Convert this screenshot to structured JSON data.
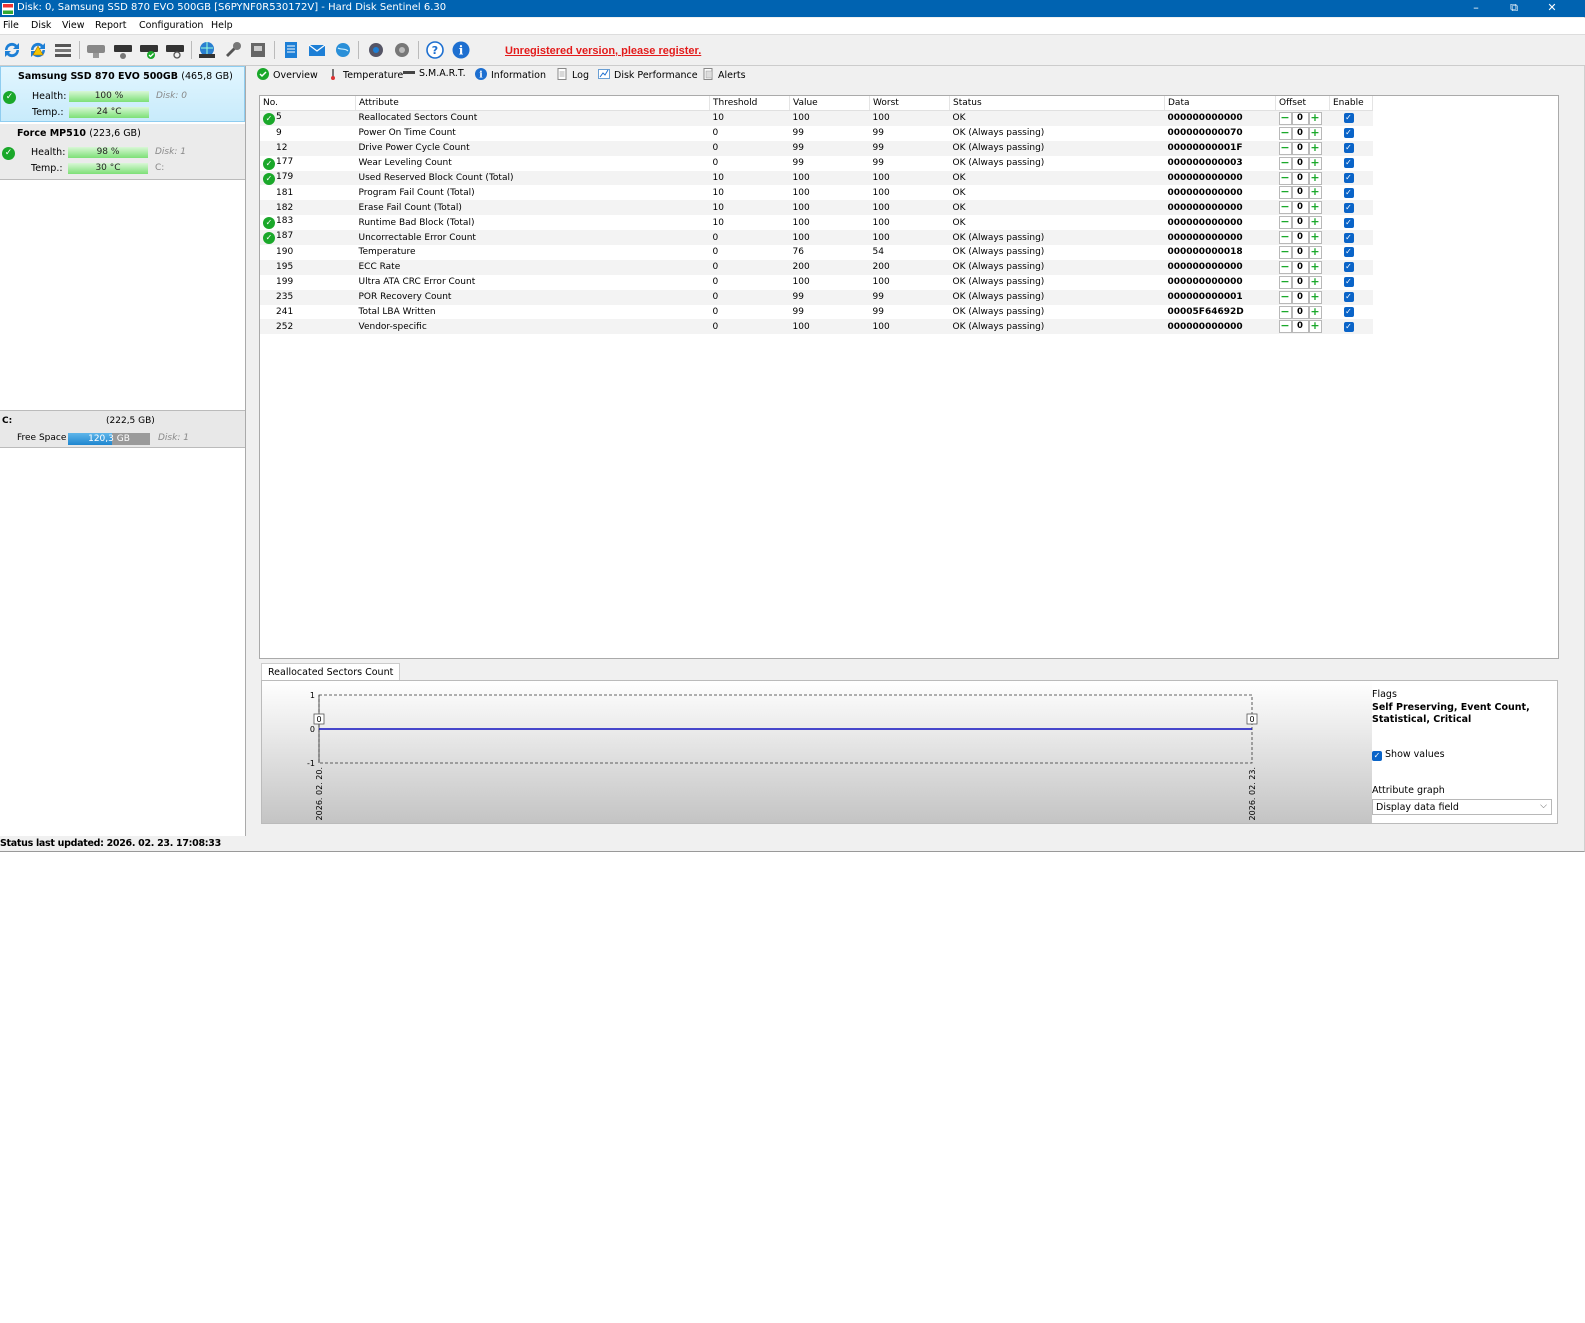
{
  "window": {
    "title": "Disk: 0, Samsung SSD 870 EVO 500GB [S6PYNF0R530172V]  -  Hard Disk Sentinel 6.30",
    "minimize": "–",
    "restore": "⧉",
    "close": "✕"
  },
  "menu": [
    "File",
    "Disk",
    "View",
    "Report",
    "Configuration",
    "Help"
  ],
  "toolbar": {
    "register_link": "Unregistered version, please register."
  },
  "disks": [
    {
      "name": "Samsung SSD 870 EVO 500GB",
      "capacity": "(465,8 GB)",
      "health_label": "Health:",
      "health": "100 %",
      "health_level": 1.0,
      "disk_label": "Disk: 0",
      "temp_label": "Temp.:",
      "temp": "24 °C",
      "extra": ""
    },
    {
      "name": "Force MP510",
      "capacity": "(223,6 GB)",
      "health_label": "Health:",
      "health": "98 %",
      "health_level": 0.98,
      "disk_label": "Disk: 1",
      "temp_label": "Temp.:",
      "temp": "30 °C",
      "extra": "C:"
    }
  ],
  "volume": {
    "letter": "C:",
    "size": "(222,5 GB)",
    "free_label": "Free Space",
    "free": "120,3 GB",
    "disk_label": "Disk: 1"
  },
  "tabs": [
    "Overview",
    "Temperature",
    "S.M.A.R.T.",
    "Information",
    "Log",
    "Disk Performance",
    "Alerts"
  ],
  "smart": {
    "headers": [
      "No.",
      "Attribute",
      "Threshold",
      "Value",
      "Worst",
      "Status",
      "Data",
      "Offset",
      "Enable"
    ],
    "rows": [
      {
        "no": "5",
        "ok": true,
        "attr": "Reallocated Sectors Count",
        "thr": "10",
        "val": "100",
        "worst": "100",
        "status": "OK",
        "data": "000000000000",
        "offset": "0"
      },
      {
        "no": "9",
        "ok": false,
        "attr": "Power On Time Count",
        "thr": "0",
        "val": "99",
        "worst": "99",
        "status": "OK (Always passing)",
        "data": "000000000070",
        "offset": "0"
      },
      {
        "no": "12",
        "ok": false,
        "attr": "Drive Power Cycle Count",
        "thr": "0",
        "val": "99",
        "worst": "99",
        "status": "OK (Always passing)",
        "data": "00000000001F",
        "offset": "0"
      },
      {
        "no": "177",
        "ok": true,
        "attr": "Wear Leveling Count",
        "thr": "0",
        "val": "99",
        "worst": "99",
        "status": "OK (Always passing)",
        "data": "000000000003",
        "offset": "0"
      },
      {
        "no": "179",
        "ok": true,
        "attr": "Used Reserved Block Count (Total)",
        "thr": "10",
        "val": "100",
        "worst": "100",
        "status": "OK",
        "data": "000000000000",
        "offset": "0"
      },
      {
        "no": "181",
        "ok": false,
        "attr": "Program Fail Count (Total)",
        "thr": "10",
        "val": "100",
        "worst": "100",
        "status": "OK",
        "data": "000000000000",
        "offset": "0"
      },
      {
        "no": "182",
        "ok": false,
        "attr": "Erase Fail Count (Total)",
        "thr": "10",
        "val": "100",
        "worst": "100",
        "status": "OK",
        "data": "000000000000",
        "offset": "0"
      },
      {
        "no": "183",
        "ok": true,
        "attr": "Runtime Bad Block (Total)",
        "thr": "10",
        "val": "100",
        "worst": "100",
        "status": "OK",
        "data": "000000000000",
        "offset": "0"
      },
      {
        "no": "187",
        "ok": true,
        "attr": "Uncorrectable Error Count",
        "thr": "0",
        "val": "100",
        "worst": "100",
        "status": "OK (Always passing)",
        "data": "000000000000",
        "offset": "0"
      },
      {
        "no": "190",
        "ok": false,
        "attr": "Temperature",
        "thr": "0",
        "val": "76",
        "worst": "54",
        "status": "OK (Always passing)",
        "data": "000000000018",
        "offset": "0"
      },
      {
        "no": "195",
        "ok": false,
        "attr": "ECC Rate",
        "thr": "0",
        "val": "200",
        "worst": "200",
        "status": "OK (Always passing)",
        "data": "000000000000",
        "offset": "0"
      },
      {
        "no": "199",
        "ok": false,
        "attr": "Ultra ATA CRC Error Count",
        "thr": "0",
        "val": "100",
        "worst": "100",
        "status": "OK (Always passing)",
        "data": "000000000000",
        "offset": "0"
      },
      {
        "no": "235",
        "ok": false,
        "attr": "POR Recovery Count",
        "thr": "0",
        "val": "99",
        "worst": "99",
        "status": "OK (Always passing)",
        "data": "000000000001",
        "offset": "0"
      },
      {
        "no": "241",
        "ok": false,
        "attr": "Total LBA Written",
        "thr": "0",
        "val": "99",
        "worst": "99",
        "status": "OK (Always passing)",
        "data": "00005F64692D",
        "offset": "0"
      },
      {
        "no": "252",
        "ok": false,
        "attr": "Vendor-specific",
        "thr": "0",
        "val": "100",
        "worst": "100",
        "status": "OK (Always passing)",
        "data": "000000000000",
        "offset": "0"
      }
    ]
  },
  "graph": {
    "tab_label": "Reallocated Sectors Count",
    "y_ticks": [
      "1",
      "0",
      "-1"
    ],
    "x_labels": [
      "2026. 02. 20.",
      "2026. 02. 23."
    ],
    "points": [
      {
        "date": "2026. 02. 20.",
        "value": 0
      },
      {
        "date": "2026. 02. 23.",
        "value": 0
      }
    ],
    "line_color": "#1010c0"
  },
  "flags": {
    "title": "Flags",
    "value": "Self Preserving, Event Count, Statistical, Critical",
    "show_values_label": "Show values",
    "attribute_graph_label": "Attribute graph",
    "attribute_graph_value": "Display data field"
  },
  "status": {
    "text": "Status last updated: 2026. 02. 23. 17:08:33"
  },
  "colors": {
    "titlebar": "#0063b1",
    "register": "#e31b1b",
    "ok_green": "#1aa82a",
    "selected_disk": "#d6f1ff"
  }
}
